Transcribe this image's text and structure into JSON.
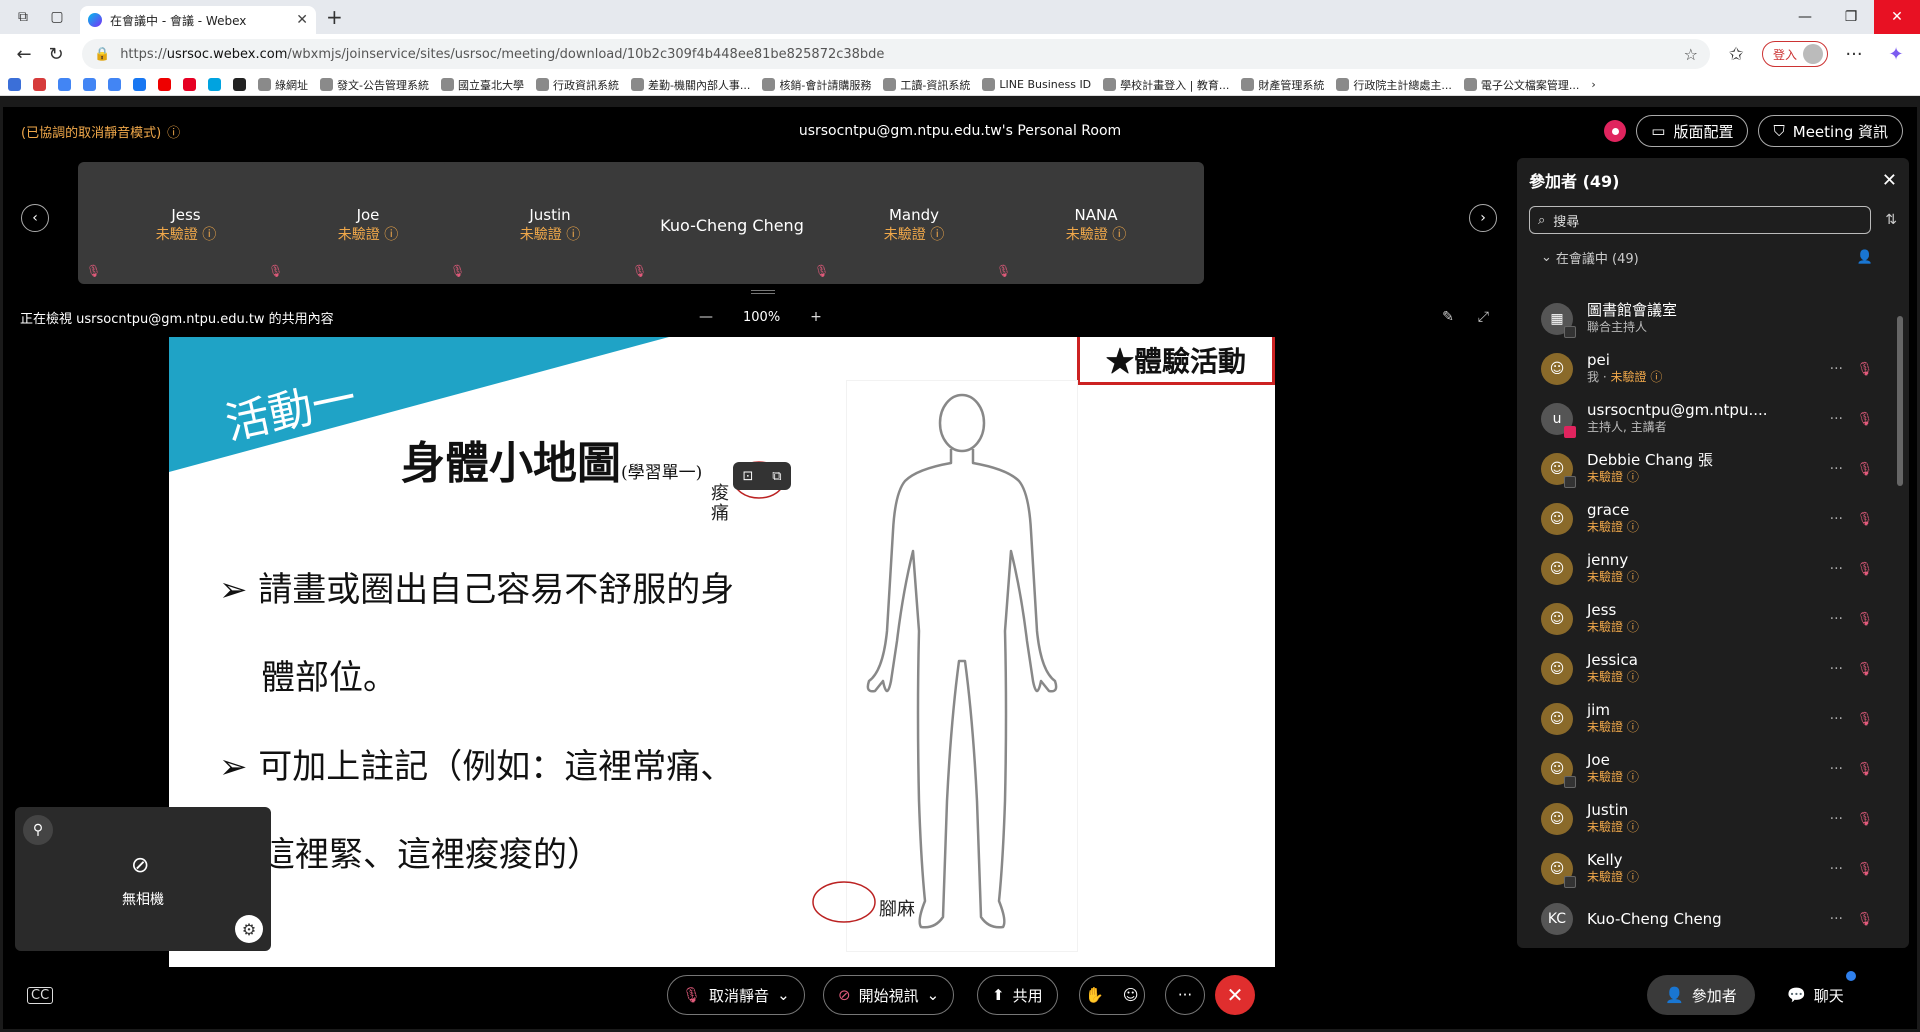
{
  "browser": {
    "tab_title": "在會議中 - 會議 - Webex",
    "url_prefix": "https://",
    "url_host": "usrsoc.webex.com",
    "url_path": "/wbxmjs/joinservice/sites/usrsoc/meeting/download/10b2c309f4b448ee81be825872c38bde",
    "signin_label": "登入",
    "bookmarks": [
      "綠網址",
      "發文-公告管理系統",
      "國立臺北大學",
      "行政資訊系統",
      "差勤-機關內部人事...",
      "核銷-會計請購服務",
      "工讀-資訊系統",
      "LINE Business ID",
      "學校計畫登入 | 教育...",
      "財產管理系統",
      "行政院主計總處主...",
      "電子公文檔案管理..."
    ]
  },
  "meeting": {
    "muted_mode": "(已協調的取消靜音模式)",
    "room_title": "usrsocntpu@gm.ntpu.edu.tw's Personal Room",
    "layout_label": "版面配置",
    "info_label": "Meeting 資訊",
    "viewing_text": "正在檢視 usrsocntpu@gm.ntpu.edu.tw 的共用內容",
    "zoom_level": "100%"
  },
  "tiles": [
    {
      "name": "Jess",
      "status": "未驗證"
    },
    {
      "name": "Joe",
      "status": "未驗證"
    },
    {
      "name": "Justin",
      "status": "未驗證"
    },
    {
      "name": "Kuo-Cheng Cheng",
      "status": ""
    },
    {
      "name": "Mandy",
      "status": "未驗證"
    },
    {
      "name": "NANA",
      "status": "未驗證"
    }
  ],
  "slide": {
    "activity": "活動一",
    "heading": "身體小地圖",
    "heading_sub": "(學習單一)",
    "badge": "★體驗活動",
    "bullet1_line1": "➢ 請畫或圈出自己容易不舒服的身",
    "bullet1_line2": "體部位。",
    "bullet2_line1": "➢ 可加上註記（例如：這裡常痛、",
    "bullet2_line2": "這裡緊、這裡痠痠的）",
    "annot_shoulder": "痠痛",
    "annot_foot": "腳麻"
  },
  "selfview": {
    "label": "無相機"
  },
  "controls": {
    "unmute": "取消靜音",
    "start_video": "開始視訊",
    "share": "共用",
    "participants": "參加者",
    "chat": "聊天"
  },
  "panel": {
    "title": "參加者 (49)",
    "search_placeholder": "搜尋",
    "group_label": "在會議中 (49)",
    "participants": [
      {
        "name": "圖書館會議室",
        "status": "聯合主持人",
        "avatar": "▦",
        "kind": "room"
      },
      {
        "name": "pei",
        "me": "我",
        "status": "未驗證",
        "avatar": "",
        "kind": "guest"
      },
      {
        "name": "usrsocntpu@gm.ntpu....",
        "status": "主持人, 主講者",
        "avatar": "u",
        "kind": "host"
      },
      {
        "name": "Debbie Chang 張",
        "status": "未驗證",
        "avatar": "",
        "kind": "guest"
      },
      {
        "name": "grace",
        "status": "未驗證",
        "avatar": "",
        "kind": "guest"
      },
      {
        "name": "jenny",
        "status": "未驗證",
        "avatar": "",
        "kind": "guest"
      },
      {
        "name": "Jess",
        "status": "未驗證",
        "avatar": "",
        "kind": "guest"
      },
      {
        "name": "Jessica",
        "status": "未驗證",
        "avatar": "",
        "kind": "guest"
      },
      {
        "name": "jim",
        "status": "未驗證",
        "avatar": "",
        "kind": "guest"
      },
      {
        "name": "Joe",
        "status": "未驗證",
        "avatar": "",
        "kind": "guest"
      },
      {
        "name": "Justin",
        "status": "未驗證",
        "avatar": "",
        "kind": "guest"
      },
      {
        "name": "Kelly",
        "status": "未驗證",
        "avatar": "",
        "kind": "guest"
      },
      {
        "name": "Kuo-Cheng Cheng",
        "status": "",
        "avatar": "KC",
        "kind": "initials"
      }
    ]
  }
}
